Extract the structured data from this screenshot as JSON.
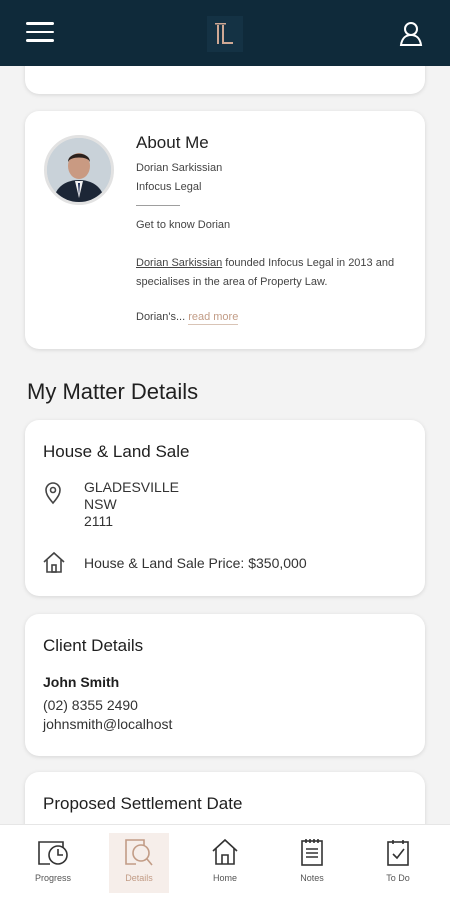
{
  "header": {
    "menu_icon": "hamburger-menu-icon",
    "logo_icon": "infocus-legal-logo",
    "profile_icon": "user-icon"
  },
  "about": {
    "title": "About Me",
    "name": "Dorian Sarkissian",
    "firm": "Infocus Legal",
    "link_text": "Get to know Dorian",
    "bio_name": "Dorian Sarkissian",
    "bio_rest": " founded Infocus Legal in 2013 and specialises in the area of Property Law.",
    "teaser": "Dorian's...",
    "read_more": "read more"
  },
  "matter": {
    "section_title": "My Matter Details",
    "property_title": "House & Land Sale",
    "address_line1": "GLADESVILLE",
    "address_line2": "NSW",
    "address_line3": "2111",
    "price_text": "House & Land Sale Price: $350,000"
  },
  "client": {
    "title": "Client Details",
    "name": "John Smith",
    "phone": "(02) 8355 2490",
    "email": "johnsmith@localhost"
  },
  "settlement": {
    "title": "Proposed Settlement Date"
  },
  "nav": {
    "items": [
      {
        "label": "Progress",
        "icon": "progress-clock-icon"
      },
      {
        "label": "Details",
        "icon": "details-search-icon",
        "active": true
      },
      {
        "label": "Home",
        "icon": "home-icon"
      },
      {
        "label": "Notes",
        "icon": "notes-icon"
      },
      {
        "label": "To Do",
        "icon": "todo-checklist-icon"
      }
    ]
  },
  "colors": {
    "header_bg": "#0f2a3a",
    "accent": "#c29c86",
    "background": "#f3f3f3"
  }
}
